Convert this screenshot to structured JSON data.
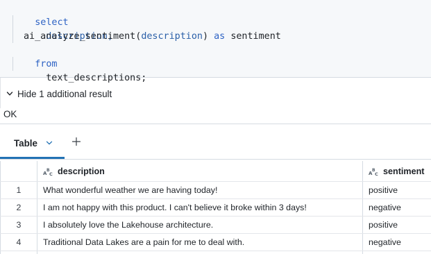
{
  "editor": {
    "lines": [
      {
        "kw": "select"
      },
      {
        "text": "description,"
      },
      {
        "fn": "ai_analyze_sentiment(",
        "arg": "description",
        "close": ")",
        "as_kw": " as ",
        "alias": "sentiment"
      },
      {
        "kw": "from"
      },
      {
        "text": "text_descriptions;"
      }
    ]
  },
  "results": {
    "toggle_label": "Hide 1 additional result",
    "status_text": "OK"
  },
  "tabs": [
    {
      "label": "Table"
    }
  ],
  "table": {
    "columns": [
      {
        "label": "description",
        "type_icon": "string-type-icon"
      },
      {
        "label": "sentiment",
        "type_icon": "string-type-icon"
      }
    ],
    "rows": [
      {
        "index": "1",
        "description": "What wonderful weather we are having today!",
        "sentiment": "positive"
      },
      {
        "index": "2",
        "description": "I am not happy with this product. I can't believe it broke within 3 days!",
        "sentiment": "negative"
      },
      {
        "index": "3",
        "description": "I absolutely love the Lakehouse architecture.",
        "sentiment": "positive"
      },
      {
        "index": "4",
        "description": "Traditional Data Lakes are a pain for me to deal with.",
        "sentiment": "negative"
      }
    ]
  },
  "colors": {
    "keyword": "#2d62c4",
    "identifier": "#2a5fa8",
    "tab_accent": "#2272b4",
    "editor_bg": "#f6f8fa"
  }
}
